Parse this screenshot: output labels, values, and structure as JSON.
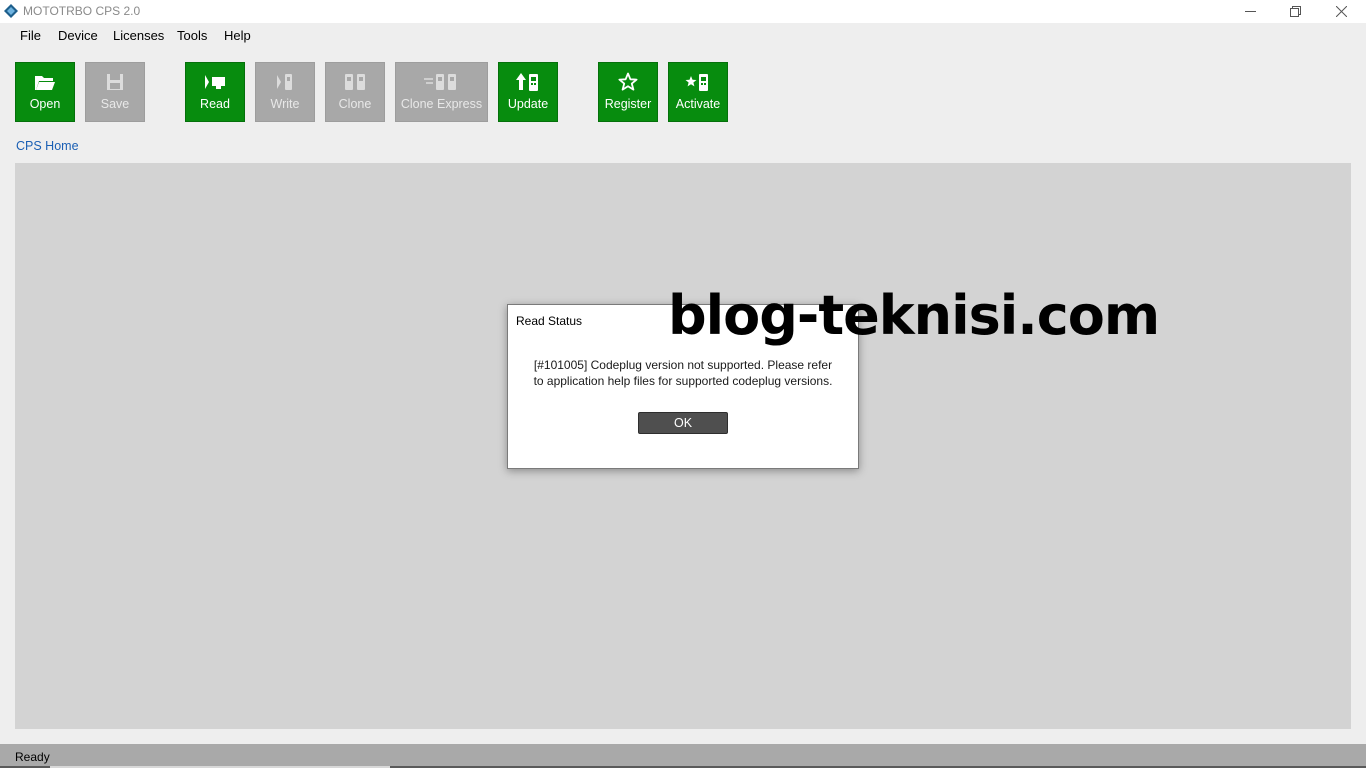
{
  "window": {
    "title": "MOTOTRBO CPS 2.0",
    "app_icon": "mototrbo-diamond-icon",
    "controls": [
      "minimize-icon",
      "restore-icon",
      "close-icon"
    ]
  },
  "menu": {
    "items": [
      "File",
      "Device",
      "Licenses",
      "Tools",
      "Help"
    ]
  },
  "toolbar": {
    "accent_color": "#078c0e",
    "disabled_color": "#a8a8a8",
    "buttons": [
      {
        "label": "Open",
        "icon": "folder-open-icon",
        "enabled": true
      },
      {
        "label": "Save",
        "icon": "floppy-disk-icon",
        "enabled": false
      },
      {
        "label": "Read",
        "icon": "radio-to-pc-icon",
        "enabled": true
      },
      {
        "label": "Write",
        "icon": "pc-to-radio-icon",
        "enabled": false
      },
      {
        "label": "Clone",
        "icon": "clone-radios-icon",
        "enabled": false
      },
      {
        "label": "Clone Express",
        "icon": "clone-express-icon",
        "enabled": false
      },
      {
        "label": "Update",
        "icon": "update-radio-icon",
        "enabled": true
      },
      {
        "label": "Register",
        "icon": "star-outline-icon",
        "enabled": true
      },
      {
        "label": "Activate",
        "icon": "star-radio-icon",
        "enabled": true
      }
    ]
  },
  "breadcrumb": {
    "label": "CPS Home"
  },
  "dialog": {
    "title": "Read Status",
    "message_line1": "[#101005] Codeplug version not supported.  Please refer",
    "message_line2": "to application help files for supported codeplug versions.",
    "ok_label": "OK"
  },
  "watermark": {
    "text": "blog-teknisi.com"
  },
  "status": {
    "text": "Ready"
  }
}
